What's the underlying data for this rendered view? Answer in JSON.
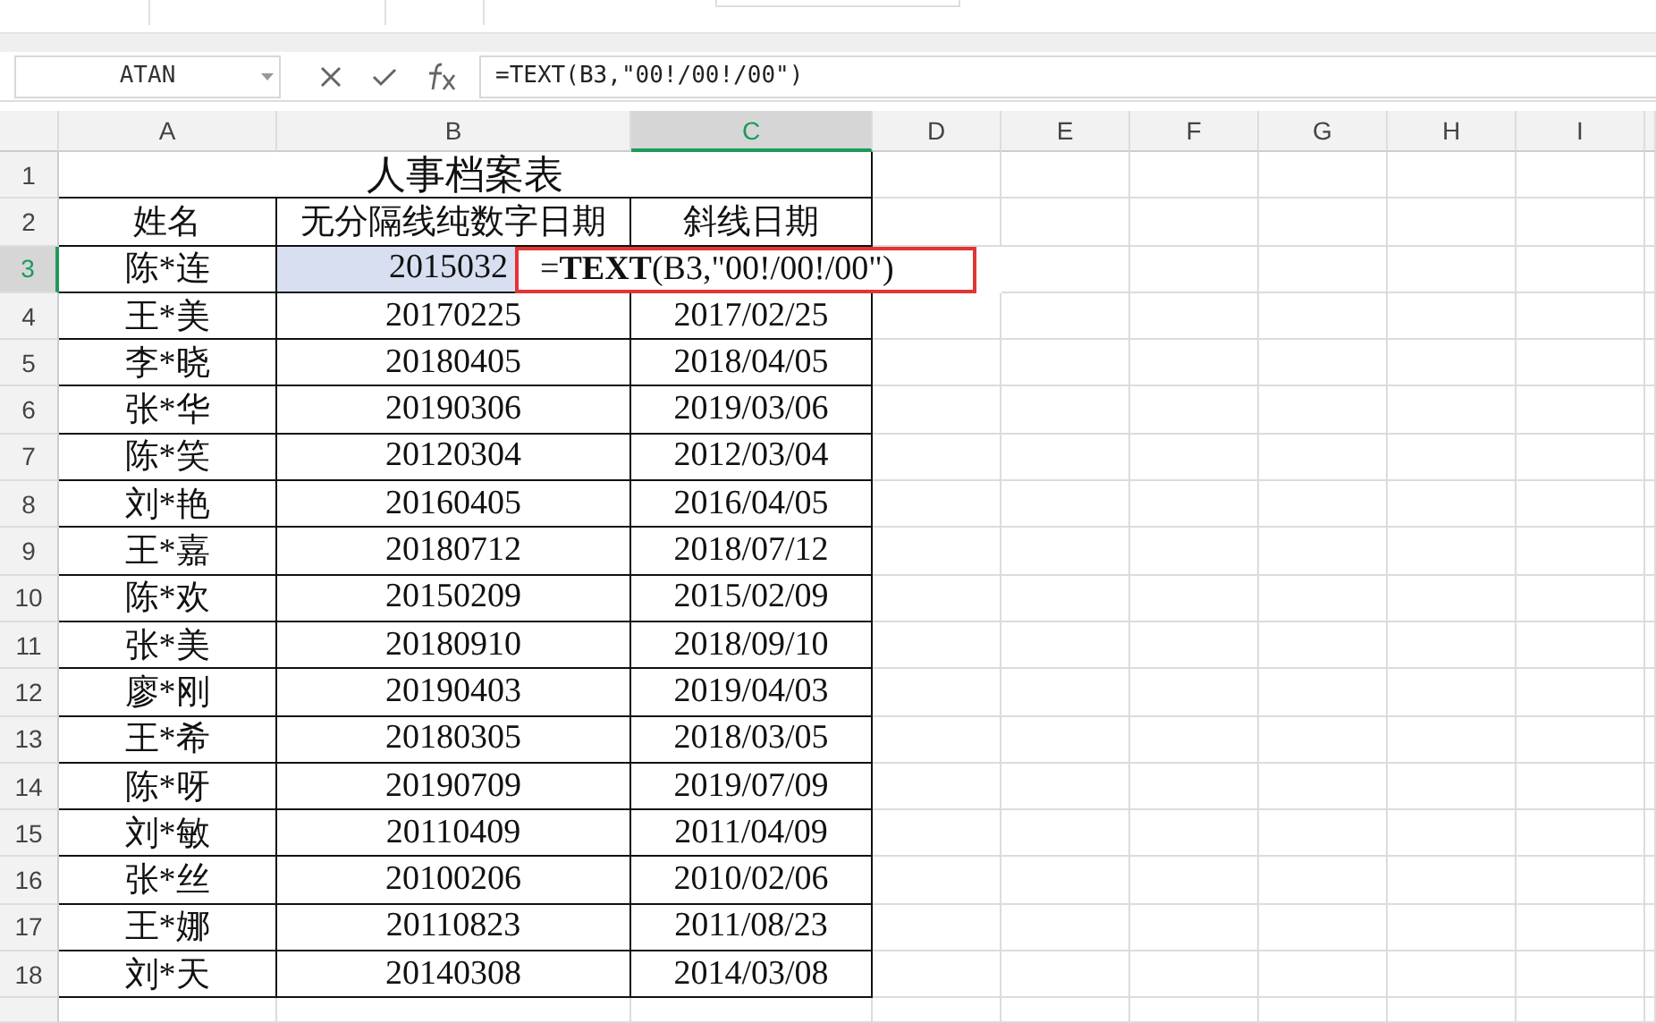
{
  "name_box": {
    "value": "ATAN"
  },
  "formula_bar": {
    "value": "=TEXT(B3,\"00!/00!/00\")"
  },
  "columns": [
    {
      "label": "A",
      "selected": false
    },
    {
      "label": "B",
      "selected": false
    },
    {
      "label": "C",
      "selected": true
    },
    {
      "label": "D",
      "selected": false
    },
    {
      "label": "E",
      "selected": false
    },
    {
      "label": "F",
      "selected": false
    },
    {
      "label": "G",
      "selected": false
    },
    {
      "label": "H",
      "selected": false
    },
    {
      "label": "I",
      "selected": false
    }
  ],
  "rows": [
    {
      "number": "1",
      "kind": "title",
      "selected": false,
      "referenced": false,
      "cells": [
        "人事档案表"
      ]
    },
    {
      "number": "2",
      "kind": "data",
      "selected": false,
      "referenced": false,
      "cells": [
        "姓名",
        "无分隔线纯数字日期",
        "斜线日期"
      ]
    },
    {
      "number": "3",
      "kind": "data",
      "selected": true,
      "referenced": true,
      "cells": [
        "陈*连",
        "2015032"
      ]
    },
    {
      "number": "4",
      "kind": "data",
      "selected": false,
      "referenced": false,
      "cells": [
        "王*美",
        "20170225",
        "2017/02/25"
      ]
    },
    {
      "number": "5",
      "kind": "data",
      "selected": false,
      "referenced": false,
      "cells": [
        "李*晓",
        "20180405",
        "2018/04/05"
      ]
    },
    {
      "number": "6",
      "kind": "data",
      "selected": false,
      "referenced": false,
      "cells": [
        "张*华",
        "20190306",
        "2019/03/06"
      ]
    },
    {
      "number": "7",
      "kind": "data",
      "selected": false,
      "referenced": false,
      "cells": [
        "陈*笑",
        "20120304",
        "2012/03/04"
      ]
    },
    {
      "number": "8",
      "kind": "data",
      "selected": false,
      "referenced": false,
      "cells": [
        "刘*艳",
        "20160405",
        "2016/04/05"
      ]
    },
    {
      "number": "9",
      "kind": "data",
      "selected": false,
      "referenced": false,
      "cells": [
        "王*嘉",
        "20180712",
        "2018/07/12"
      ]
    },
    {
      "number": "10",
      "kind": "data",
      "selected": false,
      "referenced": false,
      "cells": [
        "陈*欢",
        "20150209",
        "2015/02/09"
      ]
    },
    {
      "number": "11",
      "kind": "data",
      "selected": false,
      "referenced": false,
      "cells": [
        "张*美",
        "20180910",
        "2018/09/10"
      ]
    },
    {
      "number": "12",
      "kind": "data",
      "selected": false,
      "referenced": false,
      "cells": [
        "廖*刚",
        "20190403",
        "2019/04/03"
      ]
    },
    {
      "number": "13",
      "kind": "data",
      "selected": false,
      "referenced": false,
      "cells": [
        "王*希",
        "20180305",
        "2018/03/05"
      ]
    },
    {
      "number": "14",
      "kind": "data",
      "selected": false,
      "referenced": false,
      "cells": [
        "陈*呀",
        "20190709",
        "2019/07/09"
      ]
    },
    {
      "number": "15",
      "kind": "data",
      "selected": false,
      "referenced": false,
      "cells": [
        "刘*敏",
        "20110409",
        "2011/04/09"
      ]
    },
    {
      "number": "16",
      "kind": "data",
      "selected": false,
      "referenced": false,
      "cells": [
        "张*丝",
        "20100206",
        "2010/02/06"
      ]
    },
    {
      "number": "17",
      "kind": "data",
      "selected": false,
      "referenced": false,
      "cells": [
        "王*娜",
        "20110823",
        "2011/08/23"
      ]
    },
    {
      "number": "18",
      "kind": "data",
      "selected": false,
      "referenced": false,
      "cells": [
        "刘*天",
        "20140308",
        "2014/03/08"
      ]
    }
  ],
  "cell_editor": {
    "formula": "=**TEXT**(B3,\"00!/00!/00\")"
  }
}
